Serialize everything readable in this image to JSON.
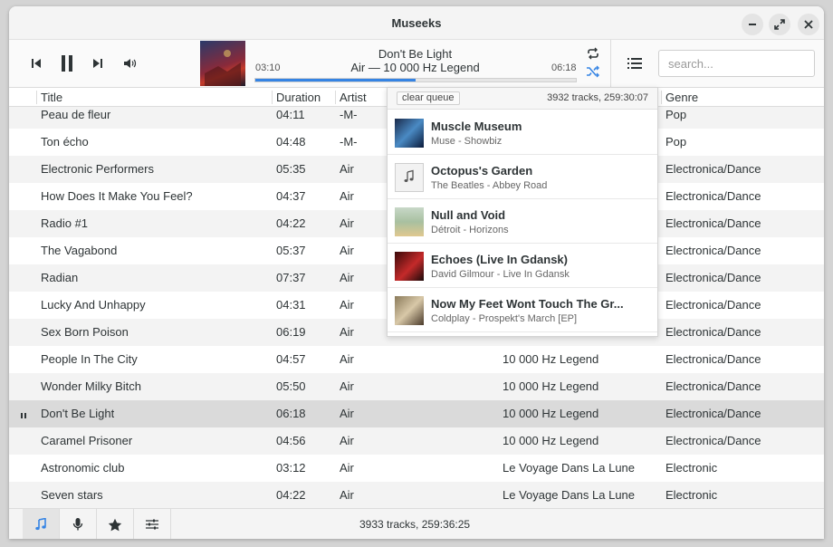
{
  "window": {
    "title": "Museeks"
  },
  "player": {
    "track_title": "Don't Be Light",
    "track_subtitle": "Air — 10 000 Hz Legend",
    "elapsed": "03:10",
    "total": "06:18",
    "progress_fraction": 0.5
  },
  "search": {
    "placeholder": "search..."
  },
  "columns": {
    "title": "Title",
    "duration": "Duration",
    "artist": "Artist",
    "genre": "Genre"
  },
  "tracks": [
    {
      "title": "Peau de fleur",
      "duration": "04:11",
      "artist": "-M-",
      "album": "",
      "genre": "Pop"
    },
    {
      "title": "Ton écho",
      "duration": "04:48",
      "artist": "-M-",
      "album": "",
      "genre": "Pop"
    },
    {
      "title": "Electronic Performers",
      "duration": "05:35",
      "artist": "Air",
      "album": "",
      "genre": "Electronica/Dance"
    },
    {
      "title": "How Does It Make You Feel?",
      "duration": "04:37",
      "artist": "Air",
      "album": "",
      "genre": "Electronica/Dance"
    },
    {
      "title": "Radio #1",
      "duration": "04:22",
      "artist": "Air",
      "album": "",
      "genre": "Electronica/Dance"
    },
    {
      "title": "The Vagabond",
      "duration": "05:37",
      "artist": "Air",
      "album": "",
      "genre": "Electronica/Dance"
    },
    {
      "title": "Radian",
      "duration": "07:37",
      "artist": "Air",
      "album": "",
      "genre": "Electronica/Dance"
    },
    {
      "title": "Lucky And Unhappy",
      "duration": "04:31",
      "artist": "Air",
      "album": "",
      "genre": "Electronica/Dance"
    },
    {
      "title": "Sex Born Poison",
      "duration": "06:19",
      "artist": "Air",
      "album": "",
      "genre": "Electronica/Dance"
    },
    {
      "title": "People In The City",
      "duration": "04:57",
      "artist": "Air",
      "album": "10 000 Hz Legend",
      "genre": "Electronica/Dance"
    },
    {
      "title": "Wonder Milky Bitch",
      "duration": "05:50",
      "artist": "Air",
      "album": "10 000 Hz Legend",
      "genre": "Electronica/Dance"
    },
    {
      "title": "Don't Be Light",
      "duration": "06:18",
      "artist": "Air",
      "album": "10 000 Hz Legend",
      "genre": "Electronica/Dance"
    },
    {
      "title": "Caramel Prisoner",
      "duration": "04:56",
      "artist": "Air",
      "album": "10 000 Hz Legend",
      "genre": "Electronica/Dance"
    },
    {
      "title": "Astronomic club",
      "duration": "03:12",
      "artist": "Air",
      "album": "Le Voyage Dans La Lune",
      "genre": "Electronic"
    },
    {
      "title": "Seven stars",
      "duration": "04:22",
      "artist": "Air",
      "album": "Le Voyage Dans La Lune",
      "genre": "Electronic"
    }
  ],
  "queue": {
    "clear_label": "clear queue",
    "summary": "3932 tracks, 259:30:07",
    "items": [
      {
        "title": "Muscle Museum",
        "subtitle": "Muse - Showbiz",
        "cover": "blue-art"
      },
      {
        "title": "Octopus's Garden",
        "subtitle": "The Beatles - Abbey Road",
        "cover": "music-note-placeholder"
      },
      {
        "title": "Null and Void",
        "subtitle": "Détroit - Horizons",
        "cover": "green-art"
      },
      {
        "title": "Echoes (Live In Gdansk)",
        "subtitle": "David Gilmour - Live In Gdansk",
        "cover": "red-art"
      },
      {
        "title": "Now My Feet Wont Touch The Gr...",
        "subtitle": "Coldplay - Prospekt's March [EP]",
        "cover": "sepia-art"
      }
    ]
  },
  "footer": {
    "status": "3933 tracks, 259:36:25"
  },
  "colors": {
    "accent": "#3584e4"
  }
}
